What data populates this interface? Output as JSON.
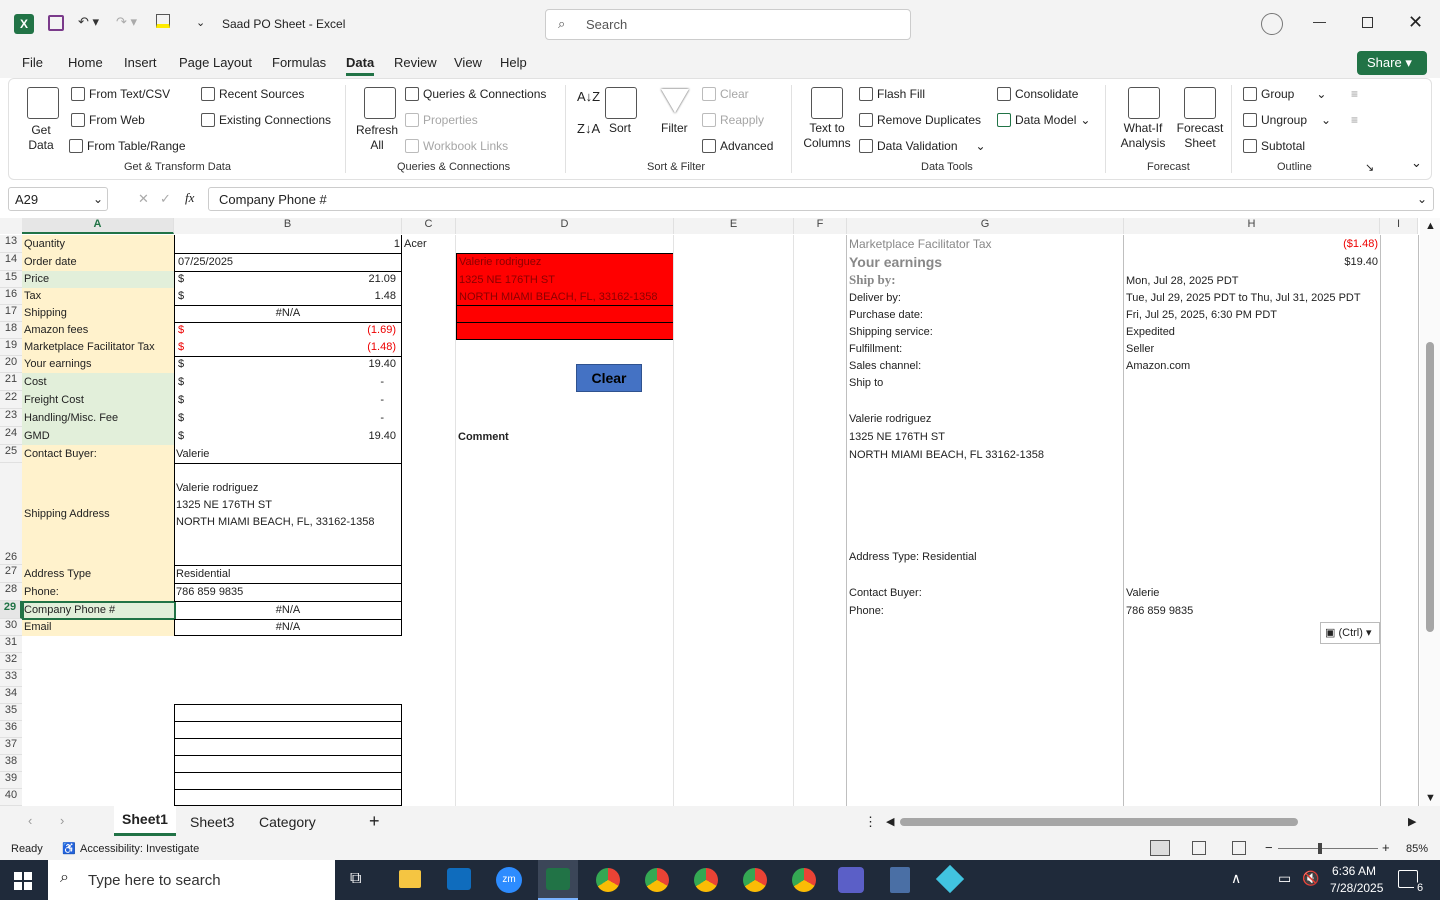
{
  "titlebar": {
    "doc_title": "Saad PO Sheet  -  Excel",
    "search_placeholder": "Search"
  },
  "ribbon_tabs": [
    "File",
    "Home",
    "Insert",
    "Page Layout",
    "Formulas",
    "Data",
    "Review",
    "View",
    "Help"
  ],
  "share_label": "Share",
  "ribbon": {
    "get_data": "Get Data",
    "from_text_csv": "From Text/CSV",
    "from_web": "From Web",
    "from_table_range": "From Table/Range",
    "recent_sources": "Recent Sources",
    "existing_connections": "Existing Connections",
    "group_get_transform": "Get & Transform Data",
    "refresh_all": "Refresh All",
    "queries_connections": "Queries & Connections",
    "properties": "Properties",
    "workbook_links": "Workbook Links",
    "group_queries": "Queries & Connections",
    "sort": "Sort",
    "filter": "Filter",
    "clear": "Clear",
    "reapply": "Reapply",
    "advanced": "Advanced",
    "group_sort_filter": "Sort & Filter",
    "text_to_columns": "Text to Columns",
    "flash_fill": "Flash Fill",
    "remove_duplicates": "Remove Duplicates",
    "data_validation": "Data Validation",
    "consolidate": "Consolidate",
    "data_model": "Data Model",
    "group_data_tools": "Data Tools",
    "what_if": "What-If Analysis",
    "forecast_sheet": "Forecast Sheet",
    "group_forecast": "Forecast",
    "group": "Group",
    "ungroup": "Ungroup",
    "subtotal": "Subtotal",
    "group_outline": "Outline"
  },
  "formula_bar": {
    "name_box": "A29",
    "fx": "fx",
    "content": "Company Phone #"
  },
  "columns": [
    "A",
    "B",
    "C",
    "D",
    "E",
    "F",
    "G",
    "H",
    "I"
  ],
  "rows": [
    "13",
    "14",
    "15",
    "16",
    "17",
    "18",
    "19",
    "20",
    "21",
    "22",
    "23",
    "24",
    "25",
    "26",
    "27",
    "28",
    "29",
    "30",
    "31",
    "32",
    "33",
    "34",
    "35",
    "36",
    "37",
    "38",
    "39",
    "40"
  ],
  "colA": [
    "Quantity",
    "Order date",
    "Price",
    "Tax",
    "Shipping",
    "Amazon fees",
    "Marketplace Facilitator Tax",
    "Your earnings",
    "Cost",
    "Freight Cost",
    "Handling/Misc. Fee",
    "GMD",
    "Contact Buyer:",
    "Shipping Address",
    "Address Type",
    "Phone:",
    "Company Phone #",
    "Email"
  ],
  "colB": {
    "quantity": "1",
    "order_date": "07/25/2025",
    "dollar": "$",
    "price": "21.09",
    "tax": "1.48",
    "shipping": "#N/A",
    "amazon_fees": "(1.69)",
    "mft": "(1.48)",
    "earnings": "19.40",
    "cost": "-",
    "freight": "-",
    "handling": "-",
    "gmd": "19.40",
    "contact": "Valerie",
    "addr1": "Valerie rodriguez",
    "addr2": "1325 NE 176TH ST",
    "addr3": "NORTH MIAMI BEACH, FL, 33162-1358",
    "addr_type": "Residential",
    "phone": "786 859 9835",
    "company_phone": "#N/A",
    "email": "#N/A"
  },
  "colC": {
    "c13": "Acer"
  },
  "colD": {
    "red1": "Valerie rodriguez",
    "red2": "1325 NE 176TH ST",
    "red3": "NORTH MIAMI BEACH, FL, 33162-1358",
    "clear_btn": "Clear",
    "comment": "Comment"
  },
  "colG": {
    "mft": "Marketplace Facilitator Tax",
    "earnings": "Your earnings",
    "ship_by": "Ship by:",
    "deliver_by": "Deliver by:",
    "purchase_date": "Purchase date:",
    "shipping_service": "Shipping service:",
    "fulfillment": "Fulfillment:",
    "sales_channel": "Sales channel:",
    "ship_to": "Ship to",
    "name": "Valerie rodriguez",
    "street": "1325 NE 176TH ST",
    "city": "NORTH MIAMI BEACH, FL 33162-1358",
    "addr_type": "Address Type:  Residential",
    "contact": "Contact Buyer:",
    "phone": "Phone:"
  },
  "colH": {
    "mft": "($1.48)",
    "earnings": "$19.40",
    "ship_by": "Mon, Jul 28, 2025 PDT",
    "deliver_by": "Tue, Jul 29, 2025 PDT to Thu, Jul 31, 2025 PDT",
    "purchase_date": "Fri, Jul 25, 2025, 6:30 PM PDT",
    "shipping_service": "Expedited",
    "fulfillment": "Seller",
    "sales_channel": "Amazon.com",
    "contact": "Valerie",
    "phone": "786 859 9835",
    "paste": "(Ctrl)"
  },
  "sheets": [
    "Sheet1",
    "Sheet3",
    "Category"
  ],
  "status": {
    "ready": "Ready",
    "accessibility": "Accessibility: Investigate",
    "zoom": "85%"
  },
  "taskbar": {
    "search_placeholder": "Type here to search",
    "time": "6:36 AM",
    "date": "7/28/2025",
    "notif": "6"
  },
  "colors": {
    "excel_green": "#217346",
    "red_block": "#ff0000",
    "tan": "#fff2cc",
    "green_cell": "#e2efda",
    "clear_btn": "#4472c4"
  }
}
